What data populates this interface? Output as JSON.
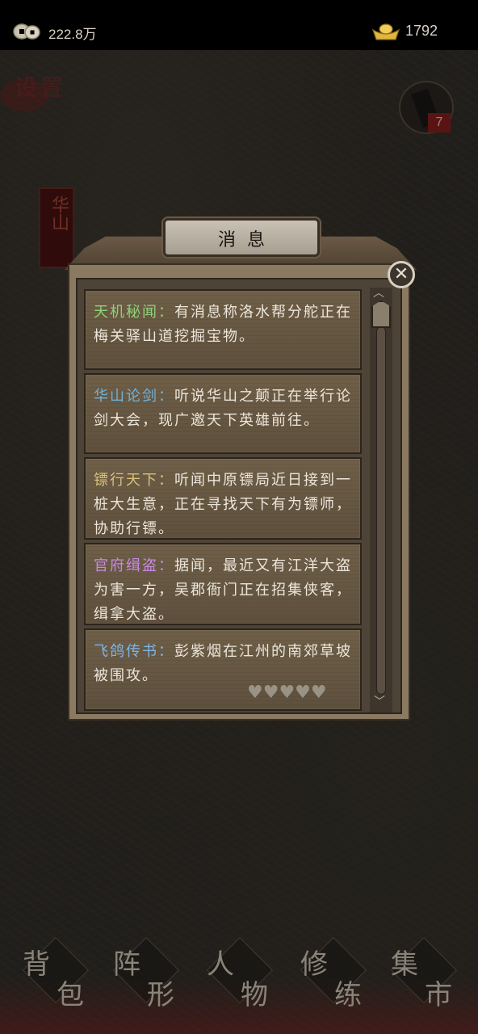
{
  "currency": {
    "coins_value": "222.8万",
    "ingots_value": "1792"
  },
  "map": {
    "settings_label": "设置",
    "location_name": "华山",
    "avatar_badge": "7"
  },
  "dialog": {
    "title": "消息",
    "close_symbol": "✕",
    "messages": [
      {
        "tag": "天机秘闻：",
        "tag_color": "#8fd17a",
        "text": "有消息称洛水帮分舵正在梅关驿山道挖掘宝物。"
      },
      {
        "tag": "华山论剑：",
        "tag_color": "#6fb2d8",
        "text": "听说华山之颠正在举行论剑大会，现广邀天下英雄前往。"
      },
      {
        "tag": "镖行天下：",
        "tag_color": "#d8c27a",
        "text": "听闻中原镖局近日接到一桩大生意，正在寻找天下有为镖师，协助行镖。"
      },
      {
        "tag": "官府缉盗：",
        "tag_color": "#c78ae0",
        "text": "据闻，最近又有江洋大盗为害一方，吴郡衙门正在招集侠客，缉拿大盗。"
      },
      {
        "tag": "飞鸽传书：",
        "tag_color": "#7fb4e6",
        "text": "彭紫烟在江州的南郊草坡被围攻。"
      }
    ],
    "hearts": "♥♥♥♥♥"
  },
  "bottom_nav": [
    {
      "c1": "背",
      "c2": "包"
    },
    {
      "c1": "阵",
      "c2": "形"
    },
    {
      "c1": "人",
      "c2": "物"
    },
    {
      "c1": "修",
      "c2": "练"
    },
    {
      "c1": "集",
      "c2": "市"
    }
  ]
}
